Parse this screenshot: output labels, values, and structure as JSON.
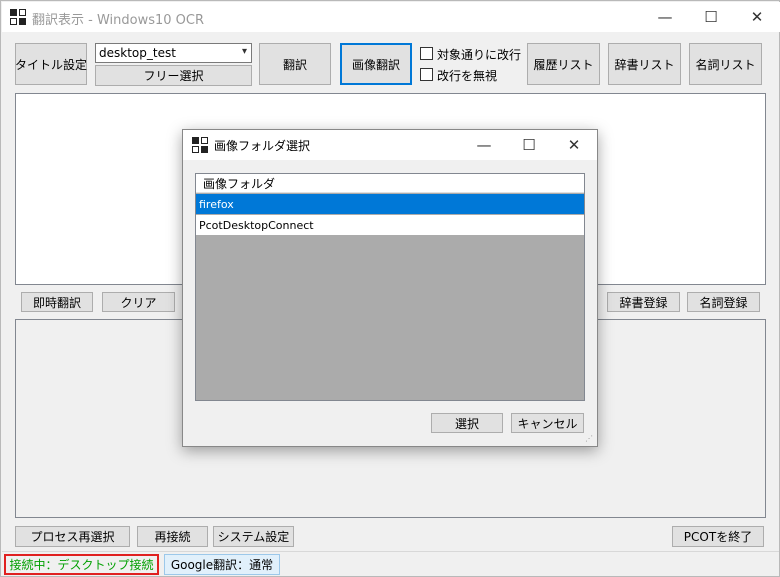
{
  "window": {
    "title": "翻訳表示 - Windows10 OCR",
    "controls": {
      "minimize": "—",
      "maximize": "☐",
      "close": "✕"
    }
  },
  "toolbar": {
    "title_setting": "タイトル設定",
    "target_select": "desktop_test",
    "free_select": "フリー選択",
    "translate": "翻訳",
    "image_translate": "画像翻訳",
    "line_break_label": "対象通りに改行",
    "ignore_break_label": "改行を無視",
    "history_list": "履歴リスト",
    "dictionary_list": "辞書リスト",
    "noun_list": "名詞リスト"
  },
  "midbar": {
    "instant_translate": "即時翻訳",
    "clear": "クリア",
    "dict_register": "辞書登録",
    "noun_register": "名詞登録"
  },
  "bottombar": {
    "process_reselect": "プロセス再選択",
    "reconnect": "再接続",
    "system_settings": "システム設定",
    "exit_pcot": "PCOTを終了"
  },
  "status": {
    "connection": "接続中：デスクトップ接続",
    "google": "Google翻訳：通常",
    "connection_color": "#00a000",
    "highlight_border": "#e02020"
  },
  "dialog": {
    "title": "画像フォルダ選択",
    "column_header": "画像フォルダ",
    "items": [
      {
        "label": "firefox",
        "selected": true
      },
      {
        "label": "PcotDesktopConnect",
        "selected": false
      }
    ],
    "ok": "選択",
    "cancel": "キャンセル",
    "accent": "#0078d7"
  }
}
